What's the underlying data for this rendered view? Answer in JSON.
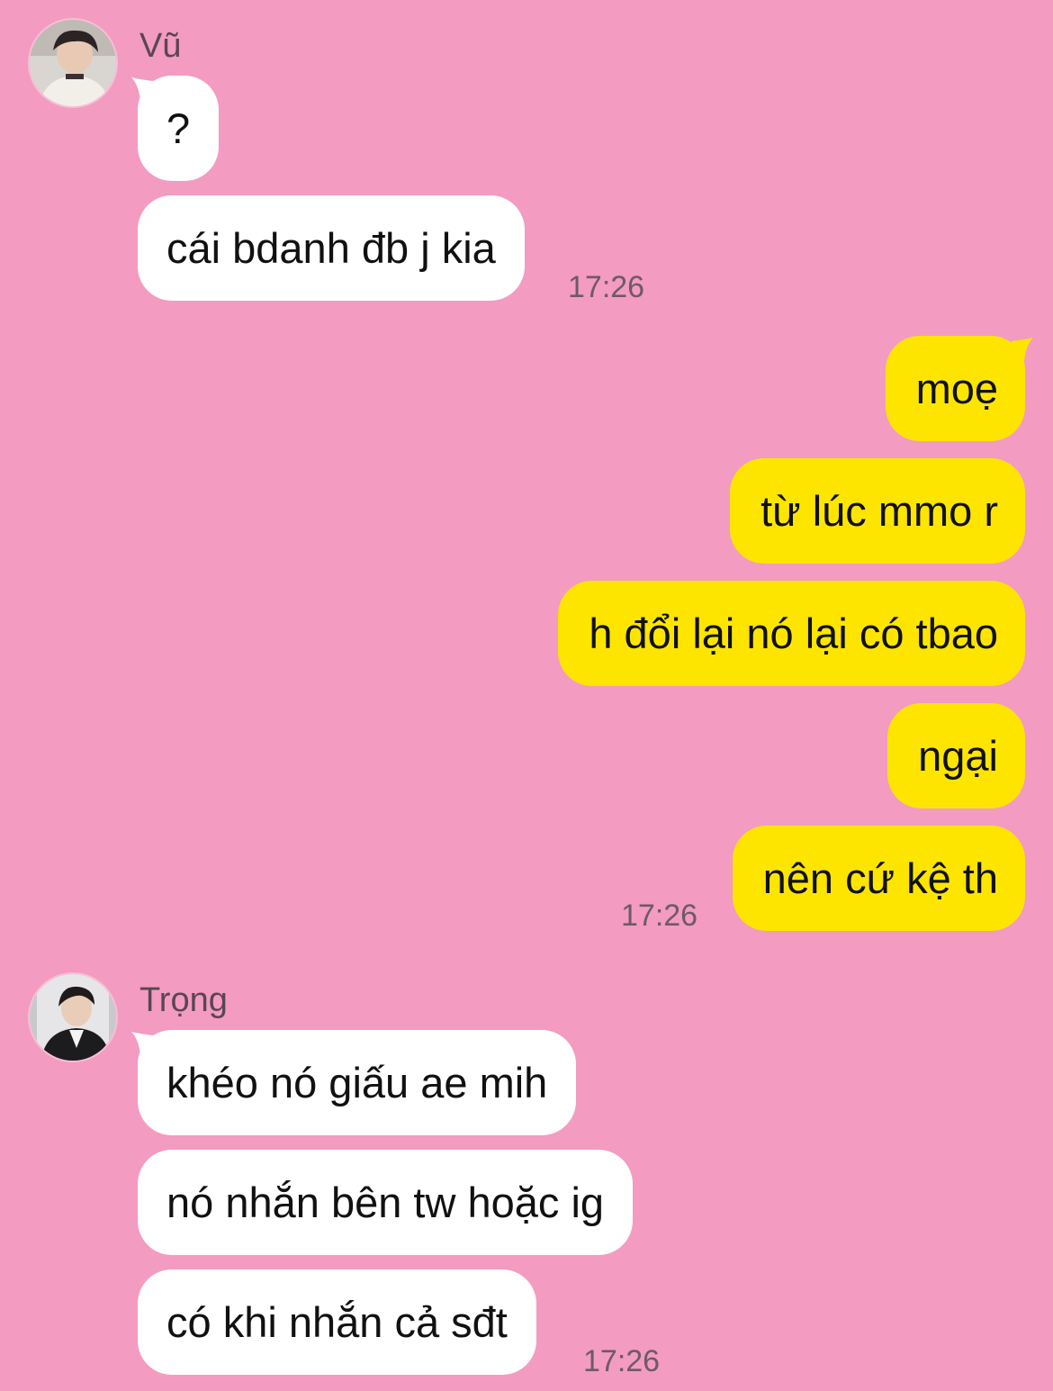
{
  "theme": {
    "background": "#f39bc1",
    "incoming_bubble": "#ffffff",
    "outgoing_bubble": "#fee500"
  },
  "group1": {
    "sender": "Vũ",
    "avatar_icon": "user-avatar-photo",
    "messages": [
      "?",
      "cái bdanh đb j kia"
    ],
    "time": "17:26"
  },
  "group2": {
    "messages": [
      "moẹ",
      "từ lúc mmo r",
      "h đổi lại nó lại có tbao",
      "ngại",
      "nên cứ kệ th"
    ],
    "time": "17:26"
  },
  "group3": {
    "sender": "Trọng",
    "avatar_icon": "user-avatar-photo",
    "messages": [
      "khéo nó giấu ae mih",
      "nó nhắn bên tw hoặc ig",
      "có khi nhắn cả sđt"
    ],
    "time": "17:26"
  }
}
